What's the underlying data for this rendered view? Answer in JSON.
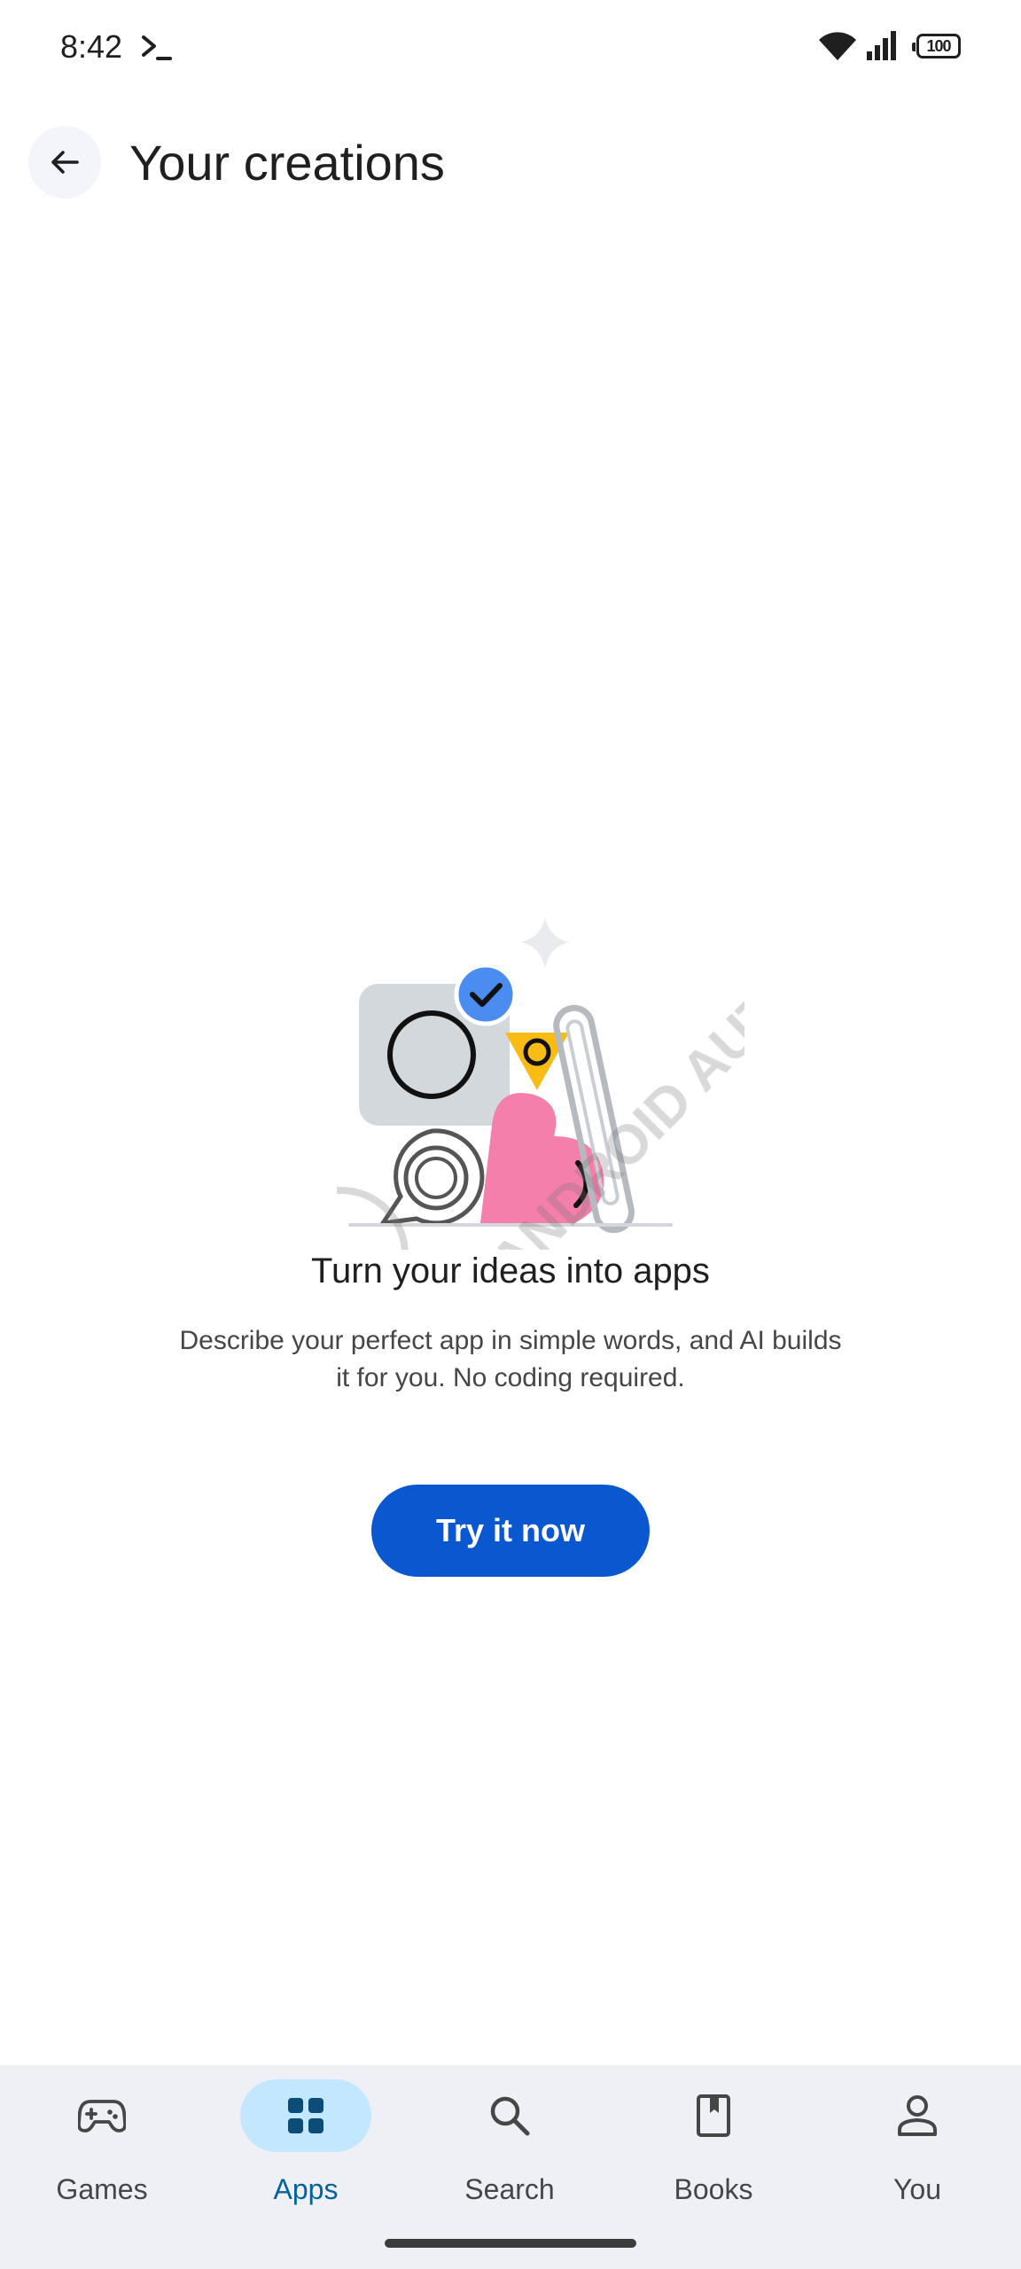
{
  "status_bar": {
    "time": "8:42",
    "battery": "100",
    "icons": [
      "terminal-icon",
      "wifi-icon",
      "signal-icon",
      "battery-icon"
    ]
  },
  "app_bar": {
    "title": "Your creations",
    "back_icon": "arrow-back-icon"
  },
  "empty_state": {
    "title": "Turn your ideas into apps",
    "description": "Describe your perfect app in simple words, and AI builds it for you. No coding required.",
    "button_label": "Try it now",
    "watermark": "ANDROID AUTHORITY"
  },
  "bottom_nav": {
    "items": [
      {
        "label": "Games",
        "icon": "gamepad-icon",
        "active": false
      },
      {
        "label": "Apps",
        "icon": "apps-grid-icon",
        "active": true
      },
      {
        "label": "Search",
        "icon": "search-icon",
        "active": false
      },
      {
        "label": "Books",
        "icon": "book-icon",
        "active": false
      },
      {
        "label": "You",
        "icon": "person-icon",
        "active": false
      }
    ]
  },
  "colors": {
    "accent": "#0b57d0",
    "active_pill": "#c2e7ff",
    "nav_background": "#eef0f6",
    "illustration_pink": "#f47faa",
    "illustration_yellow": "#f9bc15",
    "illustration_blue": "#4a8cf0"
  }
}
